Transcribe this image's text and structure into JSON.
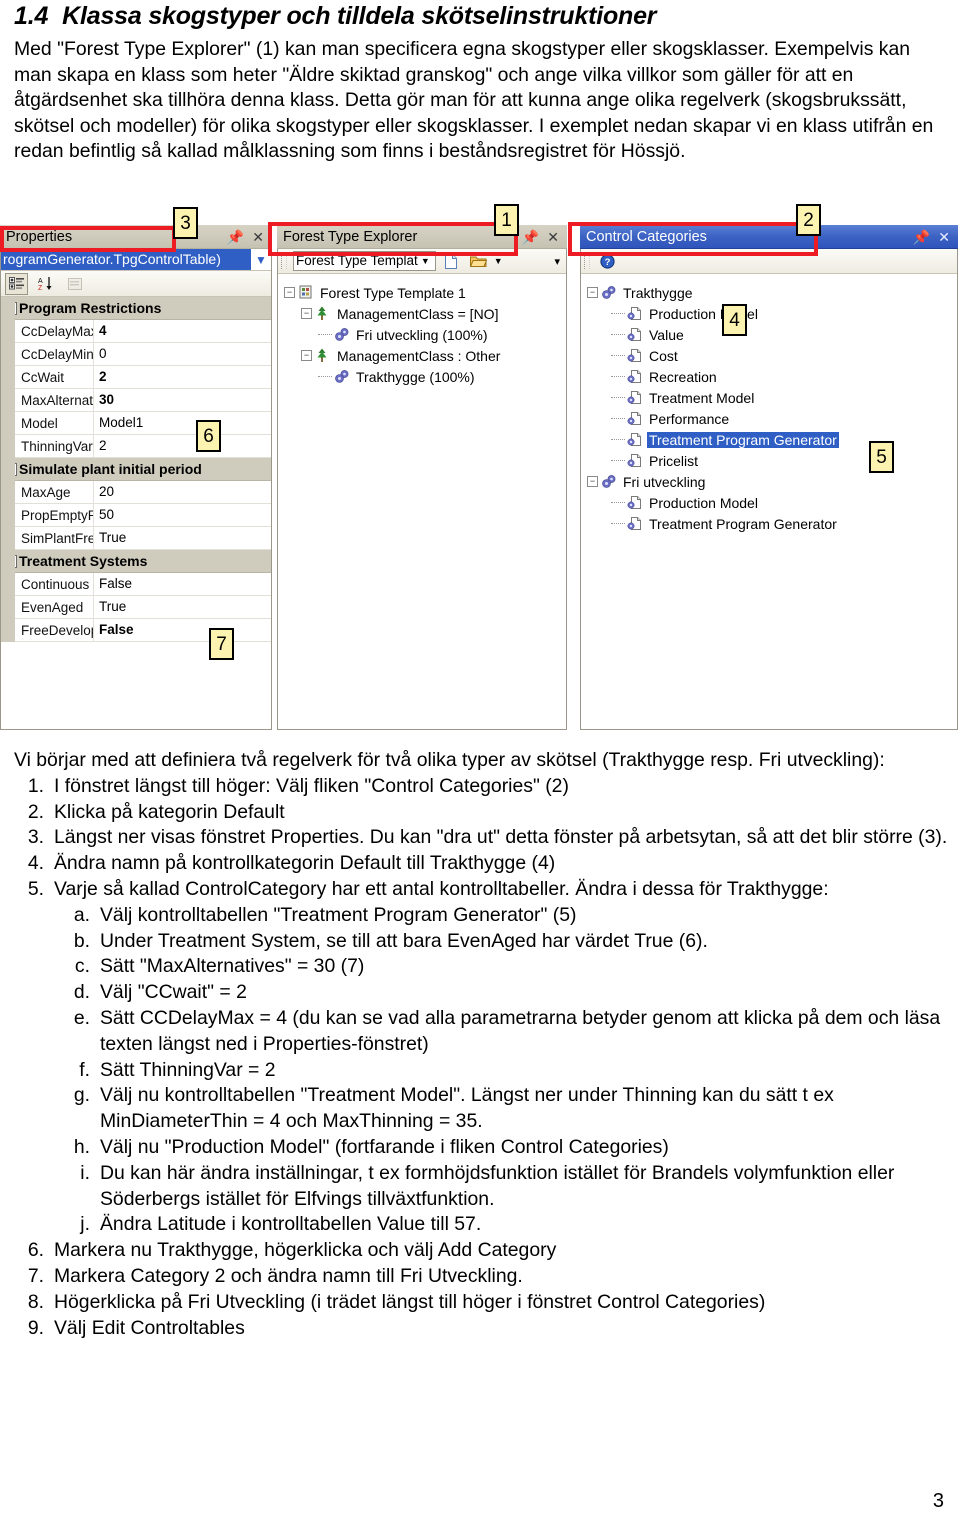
{
  "heading": {
    "number": "1.4",
    "title": "Klassa skogstyper och tilldela skötselinstruktioner"
  },
  "intro": {
    "paragraph": "Med \"Forest Type Explorer\" (1) kan man specificera egna skogstyper eller skogsklasser. Exempelvis kan man skapa en klass som heter \"Äldre skiktad granskog\" och ange vilka villkor som gäller för att en åtgärdsenhet ska tillhöra denna klass. Detta gör man för att kunna ange olika regelverk (skogsbrukssätt, skötsel och modeller) för olika skogstyper eller skogsklasser. I exemplet nedan skapar vi en klass utifrån en redan befintlig så kallad målklassning som finns i beståndsregistret för Hössjö."
  },
  "screenshot": {
    "callouts": [
      {
        "id": "1",
        "label": "1"
      },
      {
        "id": "2",
        "label": "2"
      },
      {
        "id": "3",
        "label": "3"
      },
      {
        "id": "4",
        "label": "4"
      },
      {
        "id": "5",
        "label": "5"
      },
      {
        "id": "6",
        "label": "6"
      },
      {
        "id": "7",
        "label": "7"
      }
    ],
    "properties_panel": {
      "title": "Properties",
      "pin_icon": "pin-icon",
      "close_icon": "close-icon",
      "object_combo": {
        "value": "rogramGenerator.TpgControlTable)",
        "caret_icon": "chevron-down-icon"
      },
      "toolbar": {
        "categorized_icon": "categorized-view-icon",
        "alphabetical_icon": "alphabetical-sort-icon",
        "property_pages_icon": "property-pages-icon"
      },
      "groups": [
        {
          "name": "Program Restrictions",
          "rows": [
            {
              "key": "CcDelayMax",
              "value": "4",
              "bold": true
            },
            {
              "key": "CcDelayMin",
              "value": "0",
              "bold": false
            },
            {
              "key": "CcWait",
              "value": "2",
              "bold": true
            },
            {
              "key": "MaxAlternativ",
              "value": "30",
              "bold": true
            },
            {
              "key": "Model",
              "value": "Model1",
              "bold": false
            },
            {
              "key": "ThinningVar",
              "value": "2",
              "bold": false
            }
          ]
        },
        {
          "name": "Simulate plant initial period",
          "rows": [
            {
              "key": "MaxAge",
              "value": "20",
              "bold": false
            },
            {
              "key": "PropEmptyPlo",
              "value": "50",
              "bold": false
            },
            {
              "key": "SimPlantFreeD",
              "value": "True",
              "bold": false
            }
          ]
        },
        {
          "name": "Treatment Systems",
          "rows": [
            {
              "key": "Continuous",
              "value": "False",
              "bold": false
            },
            {
              "key": "EvenAged",
              "value": "True",
              "bold": false
            },
            {
              "key": "FreeDevelopm",
              "value": "False",
              "bold": true
            }
          ]
        }
      ]
    },
    "forest_type_explorer": {
      "title": "Forest Type Explorer",
      "pin_icon": "pin-icon",
      "close_icon": "close-icon",
      "toolbar": {
        "template_combo": "Forest Type Templat",
        "caret_icon": "chevron-down-icon",
        "new_icon": "new-document-icon",
        "open_icon": "open-folder-icon",
        "open_caret_icon": "chevron-down-icon",
        "overflow_icon": "toolbar-overflow-icon"
      },
      "tree": [
        {
          "label": "Forest Type Template 1",
          "level": 0,
          "icon": "template-icon",
          "expander": "minus"
        },
        {
          "label": "ManagementClass = [NO]",
          "level": 1,
          "icon": "tree-icon",
          "expander": "minus"
        },
        {
          "label": "Fri utveckling (100%)",
          "level": 2,
          "icon": "gears-icon",
          "expander": "none"
        },
        {
          "label": "ManagementClass : Other",
          "level": 1,
          "icon": "tree-icon",
          "expander": "minus"
        },
        {
          "label": "Trakthygge (100%)",
          "level": 2,
          "icon": "gears-icon",
          "expander": "none"
        }
      ]
    },
    "control_categories": {
      "title": "Control Categories",
      "pin_icon": "pin-icon",
      "close_icon": "close-icon",
      "toolbar": {
        "help_icon": "help-icon"
      },
      "tree": [
        {
          "label": "Trakthygge",
          "level": 0,
          "icon": "gears-icon",
          "expander": "minus",
          "selected": false
        },
        {
          "label": "Production Model",
          "level": 1,
          "icon": "control-table-icon",
          "expander": "none",
          "selected": false
        },
        {
          "label": "Value",
          "level": 1,
          "icon": "control-table-icon",
          "expander": "none",
          "selected": false
        },
        {
          "label": "Cost",
          "level": 1,
          "icon": "control-table-icon",
          "expander": "none",
          "selected": false
        },
        {
          "label": "Recreation",
          "level": 1,
          "icon": "control-table-icon",
          "expander": "none",
          "selected": false
        },
        {
          "label": "Treatment Model",
          "level": 1,
          "icon": "control-table-icon",
          "expander": "none",
          "selected": false
        },
        {
          "label": "Performance",
          "level": 1,
          "icon": "control-table-icon",
          "expander": "none",
          "selected": false
        },
        {
          "label": "Treatment Program Generator",
          "level": 1,
          "icon": "control-table-icon",
          "expander": "none",
          "selected": true
        },
        {
          "label": "Pricelist",
          "level": 1,
          "icon": "control-table-icon",
          "expander": "none",
          "selected": false
        },
        {
          "label": "Fri utveckling",
          "level": 0,
          "icon": "gears-icon",
          "expander": "minus",
          "selected": false
        },
        {
          "label": "Production Model",
          "level": 1,
          "icon": "control-table-icon",
          "expander": "none",
          "selected": false
        },
        {
          "label": "Treatment Program Generator",
          "level": 1,
          "icon": "control-table-icon",
          "expander": "none",
          "selected": false
        }
      ]
    },
    "colors": {
      "callout_fill": "#fdf3b0",
      "highlight_red": "#ed1c24",
      "active_title": "#3c62c4",
      "inactive_title": "#cfccbd",
      "selection_blue": "#2f5fc4"
    }
  },
  "outro": {
    "lead": "Vi börjar med att definiera två regelverk för två olika typer av skötsel (Trakthygge resp. Fri utveckling):",
    "steps": [
      {
        "mk": "1.",
        "text": "I fönstret längst till höger: Välj fliken \"Control Categories\" (2)"
      },
      {
        "mk": "2.",
        "text": "Klicka på kategorin Default"
      },
      {
        "mk": "3.",
        "text": "Längst ner visas fönstret Properties. Du kan \"dra ut\" detta fönster på arbetsytan, så att det blir större (3)."
      },
      {
        "mk": "4.",
        "text": "Ändra namn på kontrollkategorin Default till Trakthygge (4)"
      },
      {
        "mk": "5.",
        "text": "Varje så kallad ControlCategory har ett antal kontrolltabeller. Ändra i dessa för Trakthygge:"
      },
      {
        "mk": "6.",
        "text": "Markera nu Trakthygge, högerklicka och välj Add Category"
      },
      {
        "mk": "7.",
        "text": "Markera Category 2 och ändra namn till Fri Utveckling."
      },
      {
        "mk": "8.",
        "text": "Högerklicka på Fri Utveckling (i trädet längst till höger i fönstret Control Categories)"
      },
      {
        "mk": "9.",
        "text": "Välj Edit Controltables"
      }
    ],
    "substeps": [
      {
        "mk": "a.",
        "text": "Välj kontrolltabellen \"Treatment Program Generator\" (5)"
      },
      {
        "mk": "b.",
        "text": "Under Treatment System, se till att bara EvenAged har värdet True (6)."
      },
      {
        "mk": "c.",
        "text": "Sätt \"MaxAlternatives\" = 30 (7)"
      },
      {
        "mk": "d.",
        "text": "Välj \"CCwait\" = 2"
      },
      {
        "mk": "e.",
        "text": "Sätt CCDelayMax = 4 (du kan se vad alla parametrarna betyder genom att klicka på dem och läsa texten längst ned i Properties-fönstret)"
      },
      {
        "mk": "f.",
        "text": "Sätt ThinningVar = 2"
      },
      {
        "mk": "g.",
        "text": "Välj nu kontrolltabellen \"Treatment Model\". Längst ner under Thinning kan du sätt t ex MinDiameterThin = 4 och MaxThinning = 35."
      },
      {
        "mk": "h.",
        "text": "Välj nu \"Production Model\" (fortfarande i fliken Control Categories)"
      },
      {
        "mk": "i.",
        "text": "Du kan här ändra inställningar, t ex formhöjdsfunktion istället för Brandels volymfunktion eller Söderbergs istället för Elfvings tillväxtfunktion."
      },
      {
        "mk": "j.",
        "text": "Ändra Latitude i kontrolltabellen Value till 57."
      }
    ]
  },
  "page_number": "3"
}
